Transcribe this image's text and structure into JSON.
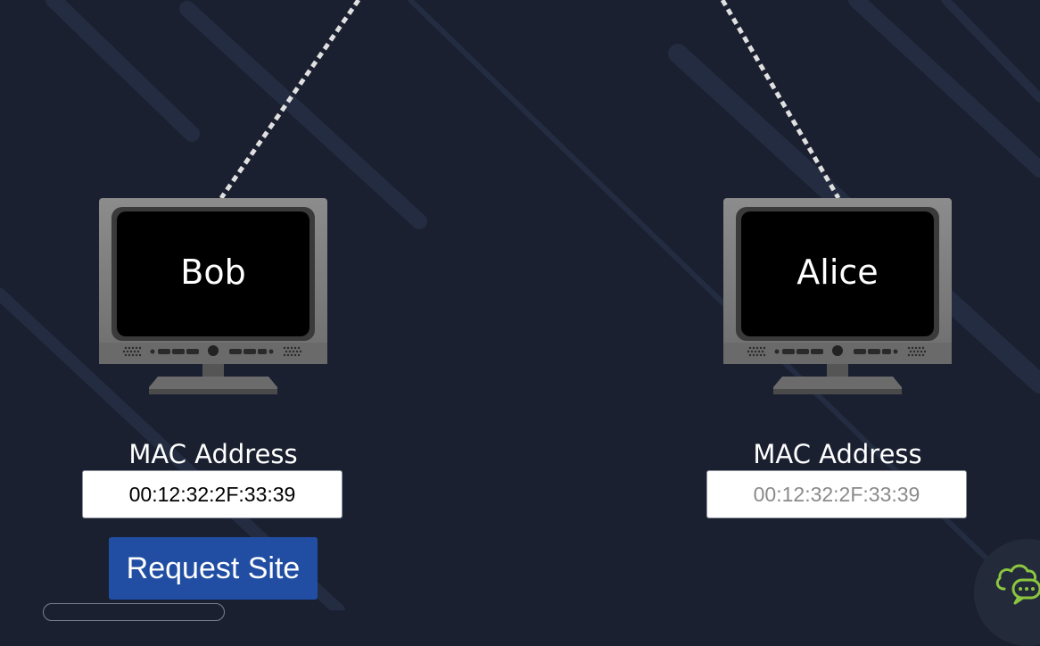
{
  "devices": [
    {
      "name": "Bob",
      "mac_label": "MAC Address",
      "mac_value": "00:12:32:2F:33:39"
    },
    {
      "name": "Alice",
      "mac_label": "MAC Address",
      "mac_placeholder": "00:12:32:2F:33:39"
    }
  ],
  "actions": {
    "request_site_label": "Request Site"
  },
  "widgets": {
    "chat_icon": "cloud-chat-icon"
  },
  "colors": {
    "background": "#1a2030",
    "button": "#214ea3",
    "chat_icon": "#8cc63f",
    "cable": "#e0e0e0"
  }
}
